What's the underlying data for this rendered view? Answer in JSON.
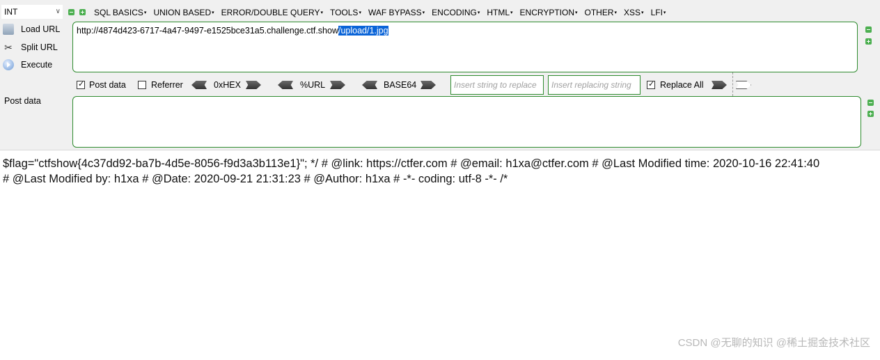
{
  "toolbar": {
    "type_select": "INT",
    "menu": [
      "SQL BASICS",
      "UNION BASED",
      "ERROR/DOUBLE QUERY",
      "TOOLS",
      "WAF BYPASS",
      "ENCODING",
      "HTML",
      "ENCRYPTION",
      "OTHER",
      "XSS",
      "LFI"
    ]
  },
  "actions": {
    "load_url": "Load URL",
    "split_url": "Split URL",
    "execute": "Execute"
  },
  "url": {
    "base": "http://4874d423-6717-4a47-9497-e1525bce31a5.challenge.ctf.show",
    "selected": "/upload/1.jpg"
  },
  "options": {
    "post_data": "Post data",
    "post_data_checked": true,
    "referrer": "Referrer",
    "referrer_checked": false,
    "hex": "0xHEX",
    "url_enc": "%URL",
    "base64": "BASE64",
    "replace_from_placeholder": "Insert string to replace",
    "replace_to_placeholder": "Insert replacing string",
    "replace_all": "Replace All",
    "replace_all_checked": true
  },
  "post": {
    "label": "Post data",
    "value": ""
  },
  "page": {
    "line1": "$flag=\"ctfshow{4c37dd92-ba7b-4d5e-8056-f9d3a3b113e1}\"; */ # @link: https://ctfer.com # @email: h1xa@ctfer.com # @Last Modified time: 2020-10-16 22:41:40",
    "line2": "# @Last Modified by: h1xa # @Date: 2020-09-21 21:31:23 # @Author: h1xa # -*- coding: utf-8 -*- /*"
  },
  "watermark": "CSDN @无聊的知识 @稀土掘金技术社区",
  "colors": {
    "border_green": "#2e8b2e",
    "selection_blue": "#0a64d8",
    "toolbar_bg": "#f0f0f0"
  }
}
